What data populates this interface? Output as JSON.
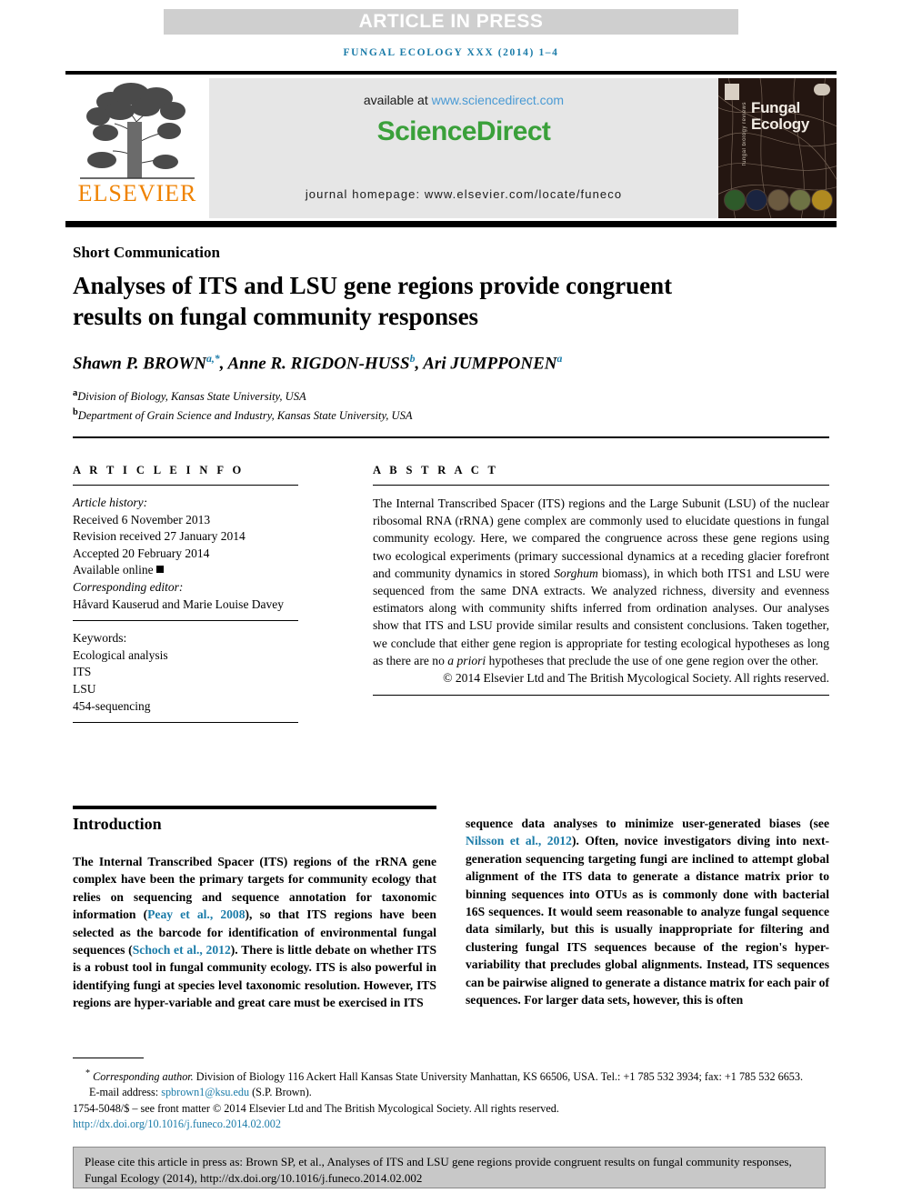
{
  "masthead": {
    "article_in_press": "ARTICLE IN PRESS",
    "journal_line": "FUNGAL ECOLOGY XXX (2014) 1–4",
    "elsevier_wordmark": "ELSEVIER",
    "available_at_prefix": "available at ",
    "available_at_link": "www.sciencedirect.com",
    "sciencedirect_logo": "ScienceDirect",
    "journal_homepage": "journal homepage: www.elsevier.com/locate/funeco",
    "cover_title_line1": "Fungal",
    "cover_title_line2": "Ecology",
    "cover_sidebar_text": "fungal biology reviews"
  },
  "article": {
    "type_label": "Short Communication",
    "title": "Analyses of ITS and LSU gene regions provide congruent results on fungal community responses",
    "authors_html": "Shawn P. BROWN<sup>a,*</sup>, Anne R. RIGDON-HUSS<sup>b</sup>, Ari JUMPPONEN<sup>a</sup>",
    "affiliations": [
      {
        "marker": "a",
        "text": "Division of Biology, Kansas State University, USA"
      },
      {
        "marker": "b",
        "text": "Department of Grain Science and Industry, Kansas State University, USA"
      }
    ]
  },
  "article_info": {
    "heading": "A R T I C L E   I N F O",
    "history_label": "Article history:",
    "received": "Received 6 November 2013",
    "revision_received": "Revision received 27 January 2014",
    "accepted": "Accepted 20 February 2014",
    "available_online": "Available online",
    "corresponding_editor_label": "Corresponding editor:",
    "corresponding_editor": "Håvard Kauserud and Marie Louise Davey",
    "keywords_label": "Keywords:",
    "keywords": [
      "Ecological analysis",
      "ITS",
      "LSU",
      "454-sequencing"
    ]
  },
  "abstract": {
    "heading": "A B S T R A C T",
    "paragraph_part1": "The Internal Transcribed Spacer (ITS) regions and the Large Subunit (LSU) of the nuclear ribosomal RNA (rRNA) gene complex are commonly used to elucidate questions in fungal community ecology. Here, we compared the congruence across these gene regions using two ecological experiments (primary successional dynamics at a receding glacier forefront and community dynamics in stored ",
    "italic_word1": "Sorghum",
    "paragraph_part2": " biomass), in which both ITS1 and LSU were sequenced from the same DNA extracts. We analyzed richness, diversity and evenness estimators along with community shifts inferred from ordination analyses. Our analyses show that ITS and LSU provide similar results and consistent conclusions. Taken together, we conclude that either gene region is appropriate for testing ecological hypotheses as long as there are no ",
    "italic_word2": "a priori",
    "paragraph_part3": " hypotheses that preclude the use of one gene region over the other.",
    "copyright": "© 2014 Elsevier Ltd and The British Mycological Society. All rights reserved."
  },
  "introduction": {
    "heading": "Introduction",
    "left_part1": "The Internal Transcribed Spacer (ITS) regions of the rRNA gene complex have been the primary targets for community ecology that relies on sequencing and sequence annotation for taxonomic information (",
    "left_cite1": "Peay et al., 2008",
    "left_part2": "), so that ITS regions have been selected as the barcode for identification of environmental fungal sequences (",
    "left_cite2": "Schoch et al., 2012",
    "left_part3": "). There is little debate on whether ITS is a robust tool in fungal community ecology. ITS is also powerful in identifying fungi at species level taxonomic resolution. However, ITS regions are hyper-variable and great care must be exercised in ITS",
    "right_part1": "sequence data analyses to minimize user-generated biases (see ",
    "right_cite1": "Nilsson et al., 2012",
    "right_part2": "). Often, novice investigators diving into next-generation sequencing targeting fungi are inclined to attempt global alignment of the ITS data to generate a distance matrix prior to binning sequences into OTUs as is commonly done with bacterial 16S sequences. It would seem reasonable to analyze fungal sequence data similarly, but this is usually inappropriate for filtering and clustering fungal ITS sequences because of the region's hyper-variability that precludes global alignments. Instead, ITS sequences can be pairwise aligned to generate a distance matrix for each pair of sequences. For larger data sets, however, this is often"
  },
  "footnote": {
    "corresponding_marker": "*",
    "corresponding_label": "Corresponding author.",
    "corresponding_address": " Division of Biology 116 Ackert Hall Kansas State University Manhattan, KS 66506, USA. Tel.: +1 785 532 3934; fax: +1 785 532 6653.",
    "email_label": "E-mail address: ",
    "email": "spbrown1@ksu.edu",
    "email_suffix": " (S.P. Brown).",
    "issn_line": "1754-5048/$ – see front matter © 2014 Elsevier Ltd and The British Mycological Society. All rights reserved.",
    "doi": "http://dx.doi.org/10.1016/j.funeco.2014.02.002"
  },
  "citation_box": {
    "text": "Please cite this article in press as: Brown SP, et al., Analyses of ITS and LSU gene regions provide congruent results on fungal community responses, Fungal Ecology (2014), http://dx.doi.org/10.1016/j.funeco.2014.02.002"
  },
  "colors": {
    "accent_link": "#1a7ba8",
    "sciencedirect_green": "#3aa03a",
    "elsevier_orange": "#ef8200",
    "banner_gray": "#cfcfcf",
    "panel_gray": "#e6e6e6",
    "citation_gray": "#c8c8c8"
  }
}
